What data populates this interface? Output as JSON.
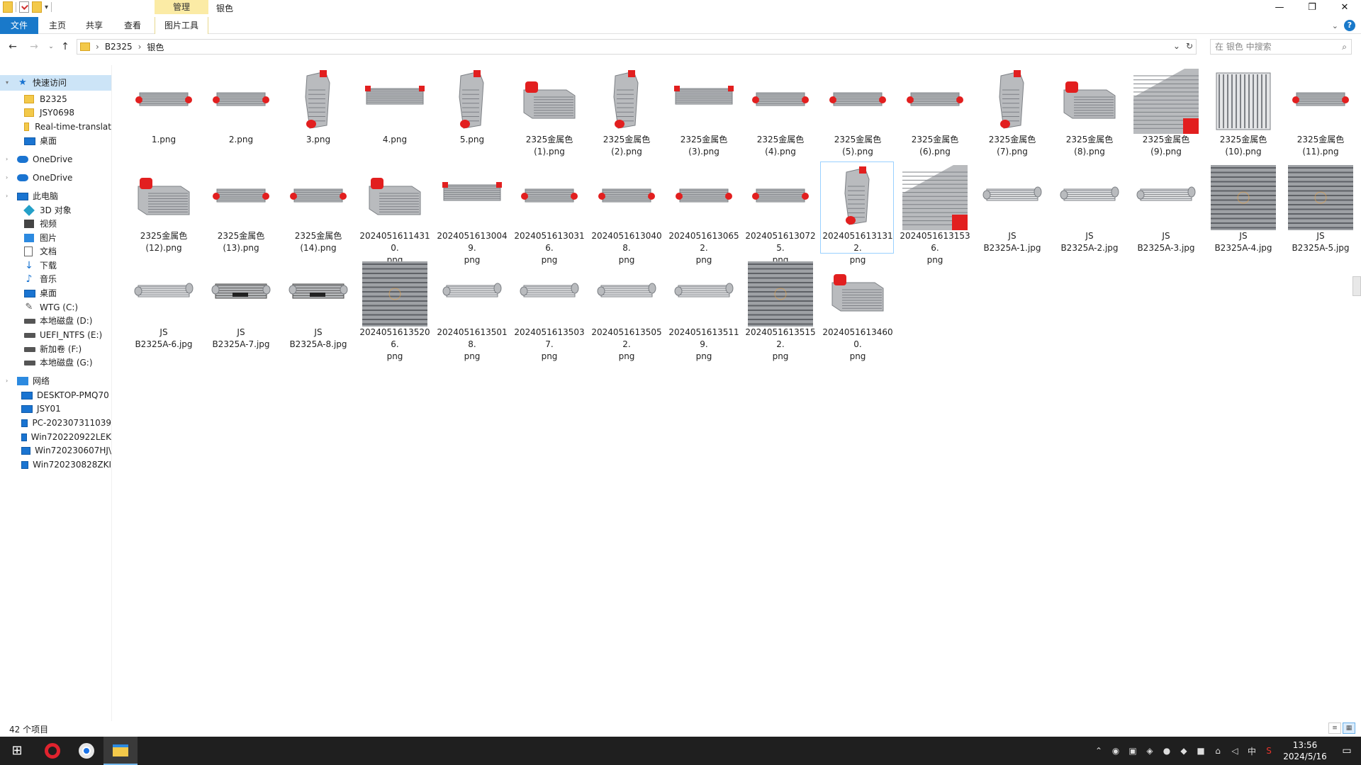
{
  "titlebar": {
    "manage_tab": "管理",
    "window_title": "银色",
    "minimize": "—",
    "maximize": "❐",
    "close": "✕"
  },
  "ribbon": {
    "file": "文件",
    "home": "主页",
    "share": "共享",
    "view": "查看",
    "picture_tools": "图片工具"
  },
  "address": {
    "crumbs": [
      "B2325",
      "银色"
    ],
    "search_placeholder": "在 银色 中搜索"
  },
  "sidebar": {
    "items": [
      {
        "label": "快速访问",
        "icon": "star-icon",
        "y": 0
      },
      {
        "label": "B2325",
        "icon": "folder-icon"
      },
      {
        "label": "JSY0698",
        "icon": "folder-icon"
      },
      {
        "label": "Real-time-translat",
        "icon": "folder-icon"
      },
      {
        "label": "桌面",
        "icon": "desktop-icon"
      },
      {
        "label": "OneDrive",
        "icon": "cloud-icon"
      },
      {
        "label": "OneDrive",
        "icon": "cloud-icon"
      },
      {
        "label": "此电脑",
        "icon": "pc-icon"
      },
      {
        "label": "3D 对象",
        "icon": "cube-icon"
      },
      {
        "label": "视频",
        "icon": "video-icon"
      },
      {
        "label": "图片",
        "icon": "picture-icon"
      },
      {
        "label": "文档",
        "icon": "document-icon"
      },
      {
        "label": "下载",
        "icon": "download-icon"
      },
      {
        "label": "音乐",
        "icon": "music-icon"
      },
      {
        "label": "桌面",
        "icon": "desktop-icon"
      },
      {
        "label": "WTG (C:)",
        "icon": "usb-drive-icon"
      },
      {
        "label": "本地磁盘 (D:)",
        "icon": "drive-icon"
      },
      {
        "label": "UEFI_NTFS (E:)",
        "icon": "drive-icon"
      },
      {
        "label": "新加卷 (F:)",
        "icon": "drive-icon"
      },
      {
        "label": "本地磁盘 (G:)",
        "icon": "drive-icon"
      },
      {
        "label": "网络",
        "icon": "network-icon"
      },
      {
        "label": "DESKTOP-PMQ70",
        "icon": "computer-icon"
      },
      {
        "label": "JSY01",
        "icon": "computer-icon"
      },
      {
        "label": "PC-202307311039",
        "icon": "computer-icon"
      },
      {
        "label": "Win720220922LEK",
        "icon": "computer-icon"
      },
      {
        "label": "Win720230607HJ\\",
        "icon": "computer-icon"
      },
      {
        "label": "Win720230828ZKI",
        "icon": "computer-icon"
      }
    ]
  },
  "files": [
    {
      "name": "1.png",
      "kind": "flat"
    },
    {
      "name": "2.png",
      "kind": "flat"
    },
    {
      "name": "3.png",
      "kind": "tall"
    },
    {
      "name": "4.png",
      "kind": "flat-wide"
    },
    {
      "name": "5.png",
      "kind": "tall"
    },
    {
      "name": "2325金属色\n(1).png",
      "kind": "angled"
    },
    {
      "name": "2325金属色\n(2).png",
      "kind": "tall"
    },
    {
      "name": "2325金属色\n(3).png",
      "kind": "flat-wide"
    },
    {
      "name": "2325金属色\n(4).png",
      "kind": "flat"
    },
    {
      "name": "2325金属色\n(5).png",
      "kind": "flat"
    },
    {
      "name": "2325金属色\n(6).png",
      "kind": "flat"
    },
    {
      "name": "2325金属色\n(7).png",
      "kind": "tall"
    },
    {
      "name": "2325金属色\n(8).png",
      "kind": "angled"
    },
    {
      "name": "2325金属色\n(9).png",
      "kind": "close"
    },
    {
      "name": "2325金属色\n(10).png",
      "kind": "front"
    },
    {
      "name": "2325金属色\n(11).png",
      "kind": "flat"
    },
    {
      "name": "2325金属色\n(12).png",
      "kind": "angled"
    },
    {
      "name": "2325金属色\n(13).png",
      "kind": "flat"
    },
    {
      "name": "2325金属色\n(14).png",
      "kind": "flat"
    },
    {
      "name": "20240516114310.png",
      "kind": "angled"
    },
    {
      "name": "20240516130049.png",
      "kind": "flat-wide"
    },
    {
      "name": "20240516130316.png",
      "kind": "flat"
    },
    {
      "name": "20240516130408.png",
      "kind": "flat"
    },
    {
      "name": "20240516130652.png",
      "kind": "flat"
    },
    {
      "name": "20240516130725.png",
      "kind": "flat"
    },
    {
      "name": "20240516131312.png",
      "kind": "tall",
      "focused": true
    },
    {
      "name": "20240516131536.png",
      "kind": "close"
    },
    {
      "name": "JS\nB2325A-1.jpg",
      "kind": "raw"
    },
    {
      "name": "JS\nB2325A-2.jpg",
      "kind": "raw"
    },
    {
      "name": "JS\nB2325A-3.jpg",
      "kind": "raw"
    },
    {
      "name": "JS\nB2325A-4.jpg",
      "kind": "raw-close"
    },
    {
      "name": "JS\nB2325A-5.jpg",
      "kind": "raw-close"
    },
    {
      "name": "JS\nB2325A-6.jpg",
      "kind": "raw"
    },
    {
      "name": "JS\nB2325A-7.jpg",
      "kind": "raw-dark"
    },
    {
      "name": "JS\nB2325A-8.jpg",
      "kind": "raw-dark"
    },
    {
      "name": "20240516135206.png",
      "kind": "raw-close"
    },
    {
      "name": "20240516135018.png",
      "kind": "raw"
    },
    {
      "name": "20240516135037.png",
      "kind": "raw"
    },
    {
      "name": "20240516135052.png",
      "kind": "raw"
    },
    {
      "name": "20240516135119.png",
      "kind": "raw"
    },
    {
      "name": "20240516135152.png",
      "kind": "raw-close"
    },
    {
      "name": "20240516134600.png",
      "kind": "angled"
    }
  ],
  "status": {
    "item_count": "42 个项目"
  },
  "taskbar": {
    "time": "13:56",
    "date": "2024/5/16",
    "ime": "中"
  },
  "colors": {
    "accent": "#1979ca",
    "manage_tab": "#fbeba5",
    "selection": "#cce4f7",
    "focus_border": "#99d1ff",
    "intercooler_red": "#e82020",
    "aluminum": "#b8babd"
  }
}
